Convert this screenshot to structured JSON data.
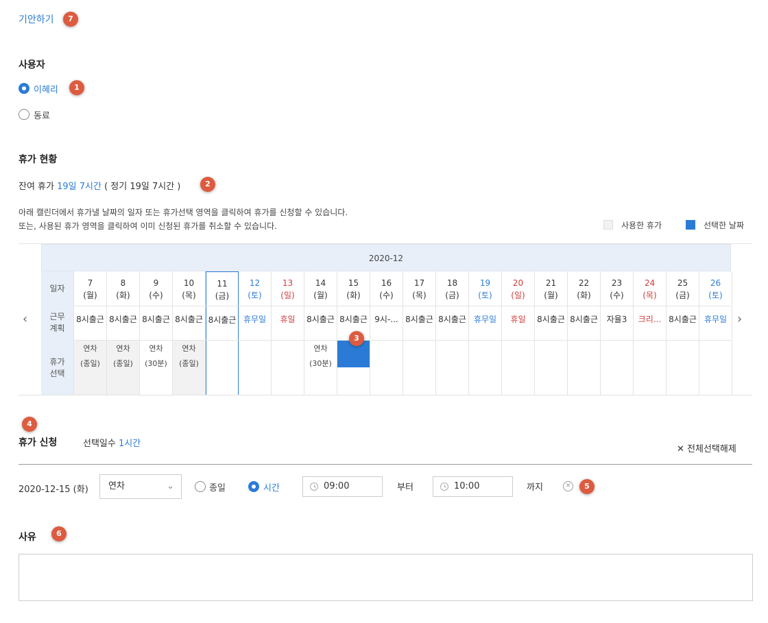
{
  "header": {
    "draft_link": "기안하기",
    "badge": "7"
  },
  "user_section": {
    "title": "사용자",
    "options": [
      {
        "label": "이혜리",
        "selected": true,
        "badge": "1"
      },
      {
        "label": "동료",
        "selected": false
      }
    ]
  },
  "status_section": {
    "title": "휴가 현황",
    "remaining_label": "잔여 휴가",
    "remaining_value": "19일 7시간",
    "regular_text": "( 정기 19일 7시간 )",
    "badge": "2",
    "instructions": [
      "아래 캘린더에서 휴가낼 날짜의 일자 또는 휴가선택 영역을 클릭하여 휴가를 신청할 수 있습니다.",
      "또는, 사용된 휴가 영역을 클릭하여 이미 신청된 휴가를 취소할 수 있습니다."
    ],
    "legend": {
      "used": "사용한 휴가",
      "selected": "선택한 날짜",
      "used_color": "#f2f2f2",
      "selected_color": "#2b7bd6"
    }
  },
  "calendar": {
    "month": "2020-12",
    "row_labels": {
      "date": "일자",
      "work_1": "근무",
      "work_2": "계획",
      "select_1": "휴가",
      "select_2": "선택"
    },
    "badge": "3",
    "days": [
      {
        "num": "7",
        "dow": "(월)",
        "type": "weekday",
        "work": "8시출근",
        "leave": "연차",
        "leave_sub": "(종일)",
        "state": "used"
      },
      {
        "num": "8",
        "dow": "(화)",
        "type": "weekday",
        "work": "8시출근",
        "leave": "연차",
        "leave_sub": "(종일)",
        "state": "used"
      },
      {
        "num": "9",
        "dow": "(수)",
        "type": "weekday",
        "work": "8시출근",
        "leave": "연차",
        "leave_sub": "(30분)",
        "state": ""
      },
      {
        "num": "10",
        "dow": "(목)",
        "type": "weekday",
        "work": "8시출근",
        "leave": "연차",
        "leave_sub": "(종일)",
        "state": "used"
      },
      {
        "num": "11",
        "dow": "(금)",
        "type": "weekday",
        "work": "8시출근",
        "leave": "",
        "leave_sub": "",
        "state": "today"
      },
      {
        "num": "12",
        "dow": "(토)",
        "type": "sat",
        "work": "휴무일",
        "leave": "",
        "leave_sub": "",
        "state": ""
      },
      {
        "num": "13",
        "dow": "(일)",
        "type": "sun",
        "work": "휴일",
        "leave": "",
        "leave_sub": "",
        "state": ""
      },
      {
        "num": "14",
        "dow": "(월)",
        "type": "weekday",
        "work": "8시출근",
        "leave": "연차",
        "leave_sub": "(30분)",
        "state": ""
      },
      {
        "num": "15",
        "dow": "(화)",
        "type": "weekday",
        "work": "8시출근",
        "leave": "",
        "leave_sub": "",
        "state": "selected"
      },
      {
        "num": "16",
        "dow": "(수)",
        "type": "weekday",
        "work": "9시-...",
        "leave": "",
        "leave_sub": "",
        "state": ""
      },
      {
        "num": "17",
        "dow": "(목)",
        "type": "weekday",
        "work": "8시출근",
        "leave": "",
        "leave_sub": "",
        "state": ""
      },
      {
        "num": "18",
        "dow": "(금)",
        "type": "weekday",
        "work": "8시출근",
        "leave": "",
        "leave_sub": "",
        "state": ""
      },
      {
        "num": "19",
        "dow": "(토)",
        "type": "sat",
        "work": "휴무일",
        "leave": "",
        "leave_sub": "",
        "state": ""
      },
      {
        "num": "20",
        "dow": "(일)",
        "type": "sun",
        "work": "휴일",
        "leave": "",
        "leave_sub": "",
        "state": ""
      },
      {
        "num": "21",
        "dow": "(월)",
        "type": "weekday",
        "work": "8시출근",
        "leave": "",
        "leave_sub": "",
        "state": ""
      },
      {
        "num": "22",
        "dow": "(화)",
        "type": "weekday",
        "work": "8시출근",
        "leave": "",
        "leave_sub": "",
        "state": ""
      },
      {
        "num": "23",
        "dow": "(수)",
        "type": "weekday",
        "work": "자율3",
        "leave": "",
        "leave_sub": "",
        "state": ""
      },
      {
        "num": "24",
        "dow": "(목)",
        "type": "sun",
        "work": "크리...",
        "leave": "",
        "leave_sub": "",
        "state": ""
      },
      {
        "num": "25",
        "dow": "(금)",
        "type": "weekday",
        "work": "8시출근",
        "leave": "",
        "leave_sub": "",
        "state": ""
      },
      {
        "num": "26",
        "dow": "(토)",
        "type": "sat",
        "work": "휴무일",
        "leave": "",
        "leave_sub": "",
        "state": ""
      }
    ]
  },
  "apply_section": {
    "badge_top": "4",
    "title": "휴가 신청",
    "count_label": "선택일수",
    "count_value": "1시간",
    "clear_all": "전체선택해제",
    "row": {
      "date": "2020-12-15 (화)",
      "type_value": "연차",
      "option_full": "종일",
      "option_time": "시간",
      "start_time": "09:00",
      "from": "부터",
      "end_time": "10:00",
      "to": "까지",
      "badge": "5"
    }
  },
  "reason_section": {
    "title": "사유",
    "badge": "6",
    "value": ""
  }
}
